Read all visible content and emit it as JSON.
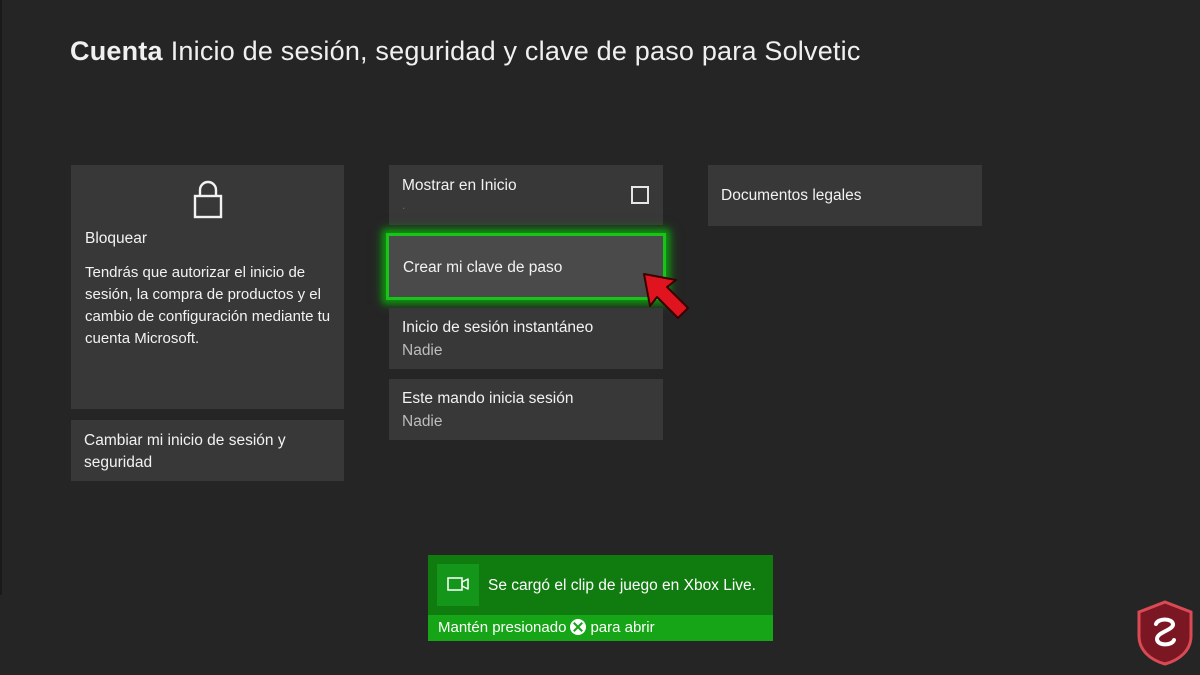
{
  "header": {
    "section": "Cuenta",
    "title": "Inicio de sesión, seguridad y clave de paso para Solvetic"
  },
  "lock_tile": {
    "icon": "lock-icon",
    "title": "Bloquear",
    "description": "Tendrás que autorizar el inicio de sesión, la compra de productos y el cambio de configuración mediante tu cuenta Microsoft."
  },
  "change_tile": {
    "label": "Cambiar mi inicio de sesión y seguridad"
  },
  "show_home_tile": {
    "label": "Mostrar en Inicio",
    "checked": false
  },
  "passkey_tile": {
    "label": "Crear mi clave de paso"
  },
  "instant_tile": {
    "label": "Inicio de sesión instantáneo",
    "value": "Nadie"
  },
  "controller_tile": {
    "label": "Este mando inicia sesión",
    "value": "Nadie"
  },
  "legal_tile": {
    "label": "Documentos legales"
  },
  "toast": {
    "icon": "video-camera-icon",
    "message": "Se cargó el clip de juego en Xbox Live.",
    "footer_prefix": "Mantén presionado",
    "footer_suffix": "para abrir"
  },
  "colors": {
    "background": "#252525",
    "tile": "#383838",
    "focus_green": "#18c418",
    "toast_green": "#107c10",
    "arrow_red": "#e0141e"
  }
}
